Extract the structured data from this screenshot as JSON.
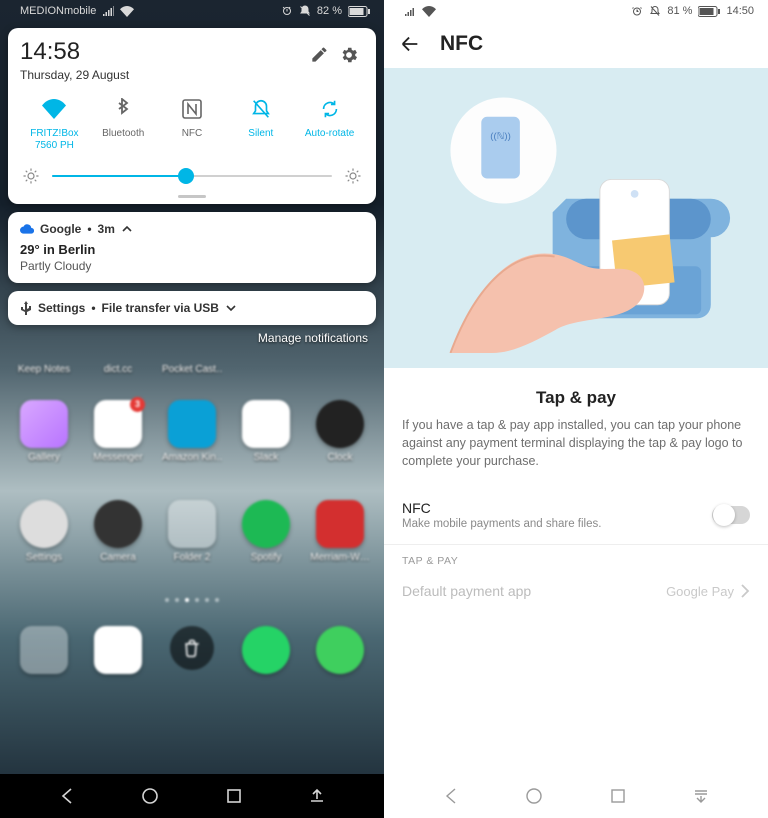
{
  "left": {
    "status_bar": {
      "carrier": "MEDIONmobile",
      "battery_pct": "82 %"
    },
    "time": "14:58",
    "date": "Thursday, 29 August",
    "tiles": [
      {
        "name": "wifi-tile",
        "label": "FRITZ!Box 7560 PH",
        "active": true
      },
      {
        "name": "bluetooth-tile",
        "label": "Bluetooth",
        "active": false
      },
      {
        "name": "nfc-tile",
        "label": "NFC",
        "active": false
      },
      {
        "name": "silent-tile",
        "label": "Silent",
        "active": true
      },
      {
        "name": "autorotate-tile",
        "label": "Auto-rotate",
        "active": true
      }
    ],
    "brightness_pct": 48,
    "notifs": [
      {
        "app": "Google",
        "age": "3m",
        "title": "29° in Berlin",
        "subtitle": "Partly Cloudy"
      },
      {
        "app": "Settings",
        "title_inline": "File transfer via USB"
      }
    ],
    "manage_label": "Manage notifications",
    "home_rows": [
      [
        "Keep Notes",
        "dict.cc",
        "Pocket Cast…",
        "",
        ""
      ],
      [
        "Gallery",
        "Messenger",
        "Amazon Kin…",
        "Slack",
        "Clock"
      ],
      [
        "Settings",
        "Camera",
        "Folder 2",
        "Spotify",
        "Merriam-W…"
      ]
    ],
    "messenger_badge": "3"
  },
  "right": {
    "status_bar": {
      "battery_pct": "81 %",
      "time": "14:50"
    },
    "header_title": "NFC",
    "section_title": "Tap & pay",
    "section_body": "If you have a tap & pay app installed, you can tap your phone against any payment terminal displaying the tap & pay logo to complete your purchase.",
    "nfc_row": {
      "title": "NFC",
      "subtitle": "Make mobile payments and share files.",
      "enabled": false
    },
    "category_label": "TAP & PAY",
    "default_app_row": {
      "title": "Default payment app",
      "value": "Google Pay",
      "disabled": true
    }
  }
}
